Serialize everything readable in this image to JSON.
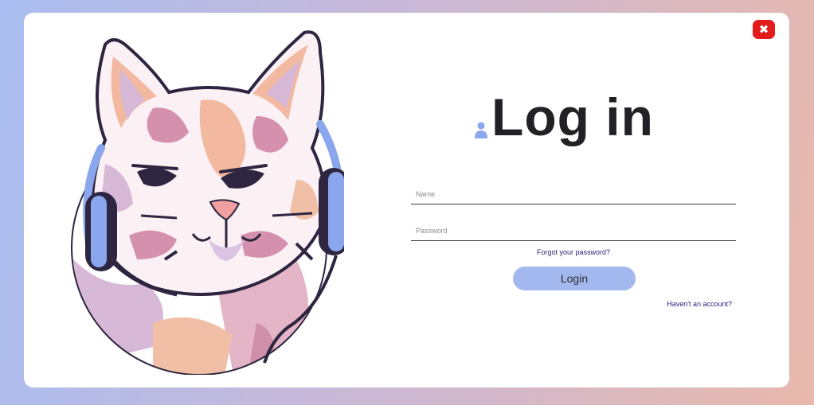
{
  "login": {
    "title": "Log in",
    "name_placeholder": "Name",
    "password_placeholder": "Password",
    "forgot_password": "Forgot your password?",
    "login_button": "Login",
    "no_account": "Haven't an account?"
  },
  "icons": {
    "close": "close-icon",
    "user": "user-icon",
    "illustration": "cat-with-headphones-illustration"
  },
  "colors": {
    "close": "#e21b1b",
    "login_button": "#a3b8ee",
    "link": "#2b1f78",
    "title": "#222226"
  }
}
